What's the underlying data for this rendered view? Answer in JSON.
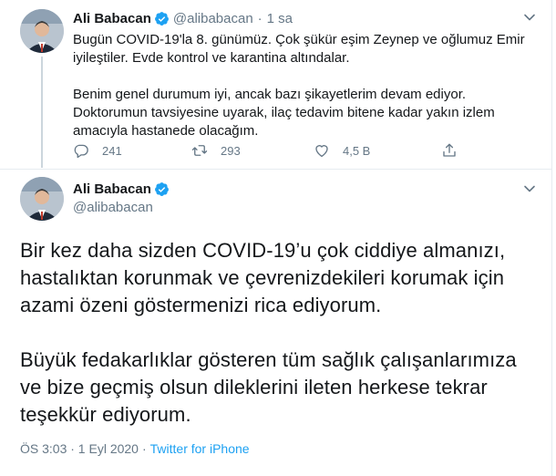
{
  "tweet1": {
    "author_name": "Ali Babacan",
    "handle": "@alibabacan",
    "dot": "·",
    "time": "1 sa",
    "paragraph1": "Bugün COVID-19'la 8. günümüz. Çok şükür eşim Zeynep ve oğlumuz Emir iyileştiler. Evde kontrol ve karantina altındalar.",
    "paragraph2": "Benim genel durumum iyi, ancak bazı şikayetlerim devam ediyor. Doktorumun tavsiyesine uyarak, ilaç tedavim bitene kadar yakın izlem amacıyla hastanede olacağım.",
    "reply_count": "241",
    "retweet_count": "293",
    "like_count": "4,5 B"
  },
  "tweet2": {
    "author_name": "Ali Babacan",
    "handle": "@alibabacan",
    "paragraph1": "Bir kez daha sizden COVID-19’u çok ciddiye almanızı, hastalıktan korunmak ve çevrenizdekileri korumak için azami özeni göstermenizi rica ediyorum.",
    "paragraph2": "Büyük fedakarlıklar gösteren tüm sağlık çalışanlarımıza ve bize geçmiş olsun dileklerini ileten herkese tekrar teşekkür ediyorum.",
    "timestamp": "ÖS 3:03 · 1 Eyl 2020",
    "separator": "·",
    "source": "Twitter for iPhone"
  },
  "icons": {
    "verified": "verified-badge-icon",
    "caret": "chevron-down-icon",
    "reply": "reply-icon",
    "retweet": "retweet-icon",
    "like": "heart-icon",
    "share": "share-icon"
  },
  "colors": {
    "accent": "#1da1f2",
    "text": "#14171a",
    "secondary": "#657786",
    "border": "#e6ecf0"
  }
}
